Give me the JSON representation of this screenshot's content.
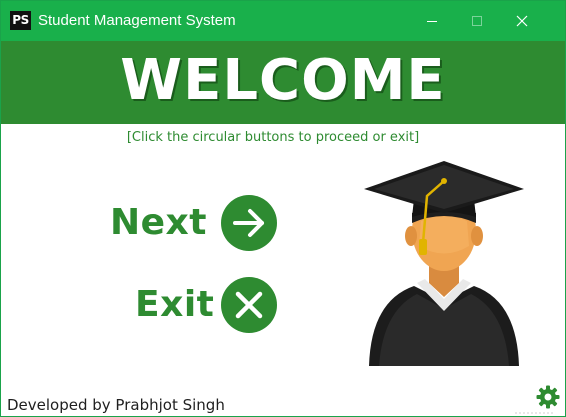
{
  "window": {
    "app_icon_text": "PS",
    "title": "Student Management System",
    "controls": [
      "minimize",
      "maximize",
      "close"
    ]
  },
  "banner": {
    "title": "WELCOME"
  },
  "hint": "[Click the circular buttons to proceed or exit]",
  "actions": {
    "next_label": "Next",
    "next_icon": "arrow-right-icon",
    "exit_label": "Exit",
    "exit_icon": "x-icon"
  },
  "illustration": "graduate-student-icon",
  "footer": {
    "credit": "Developed by Prabhjot Singh",
    "settings_icon": "gear-icon"
  },
  "colors": {
    "titlebar": "#19b04b",
    "banner": "#2e8b31",
    "accent": "#2e8b31",
    "background": "#ffffff"
  }
}
